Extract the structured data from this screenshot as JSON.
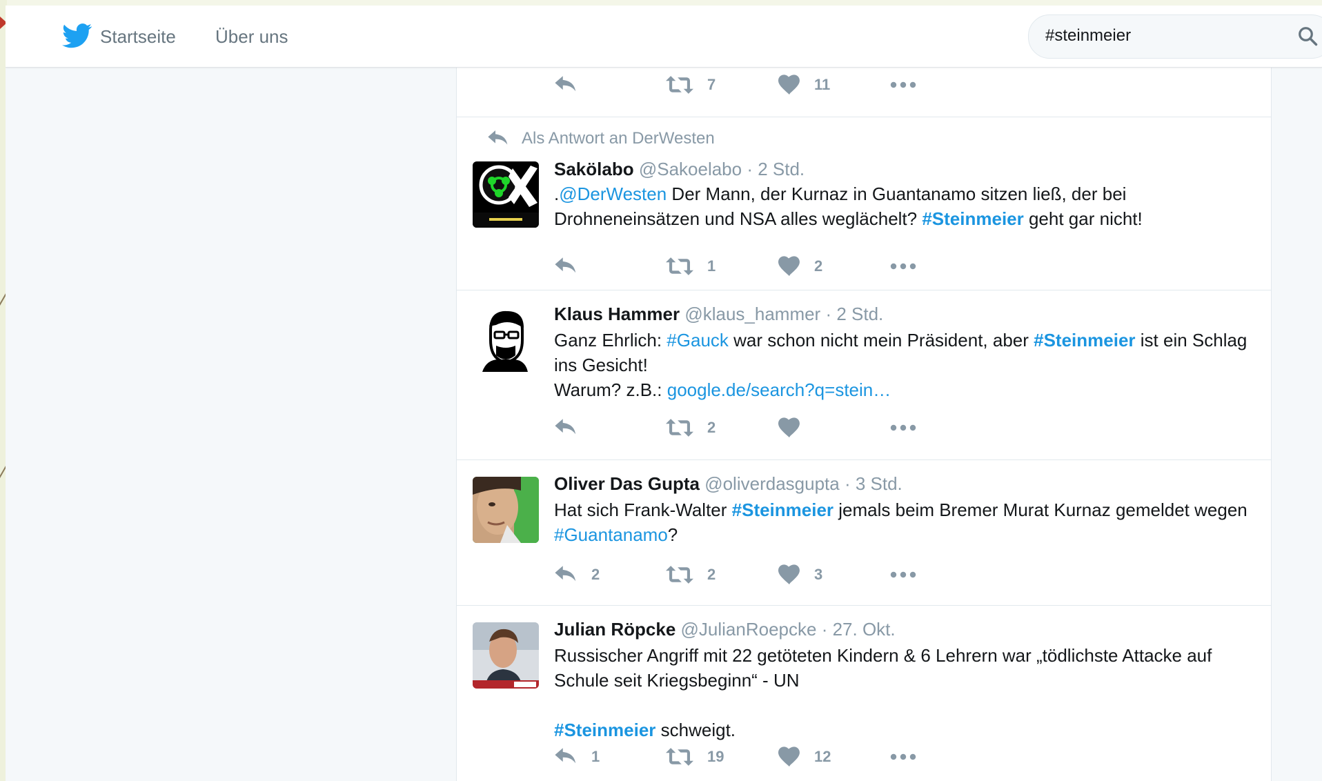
{
  "nav": {
    "home_label": "Startseite",
    "about_label": "Über uns",
    "search_value": "#steinmeier"
  },
  "colors": {
    "twitter_blue": "#1da1f2",
    "link_blue": "#1b95e0",
    "muted_gray": "#8899a6"
  },
  "tweets": [
    {
      "retweets": "7",
      "likes": "11"
    },
    {
      "context": "Als Antwort an DerWesten",
      "name": "Sakölabo",
      "handle": "@Sakoelabo",
      "time": "· 2 Std.",
      "text": {
        "p1": ".",
        "mention": "@DerWesten",
        "p2": " Der Mann, der Kurnaz in Guantanamo sitzen ließ, der bei Drohneneinsätzen und NSA alles wegläche​lt? ",
        "hashtag": "#Steinmeier",
        "p3": " geht gar nicht!"
      },
      "retweets": "1",
      "likes": "2"
    },
    {
      "name": "Klaus Hammer",
      "handle": "@klaus_hammer",
      "time": "· 2 Std.",
      "text": {
        "p1": "Ganz Ehrlich: ",
        "hashtag1": "#Gauck",
        "p2": " war schon nicht mein Präsident, aber ",
        "hashtag2": "#Steinmeier",
        "p3": " ist ein Schlag ins Gesicht!",
        "p4": "Warum? z.B.: ",
        "url": "google.de/search?q=stein…"
      },
      "retweets": "2",
      "likes": ""
    },
    {
      "name": "Oliver Das Gupta",
      "handle": "@oliverdasgupta",
      "time": "· 3 Std.",
      "text": {
        "p1": "Hat sich Frank-Walter ",
        "hashtag1": "#Steinmeier",
        "p2": " jemals beim Bremer Murat Kurnaz gemeldet wegen ",
        "hashtag2": "#Guantanamo",
        "p3": "?"
      },
      "replies": "2",
      "retweets": "2",
      "likes": "3"
    },
    {
      "name": "Julian Röpcke",
      "handle": "@JulianRoepcke",
      "time": "· 27. Okt.",
      "text": {
        "p1": "Russischer Angriff mit 22 getöteten Kindern & 6 Lehrern war „tödlichste Attacke auf Schule seit Kriegsbeginn“ - UN",
        "hashtag": "#Steinmeier",
        "p2": " schweigt."
      },
      "replies": "1",
      "retweets": "19",
      "likes": "12"
    }
  ]
}
